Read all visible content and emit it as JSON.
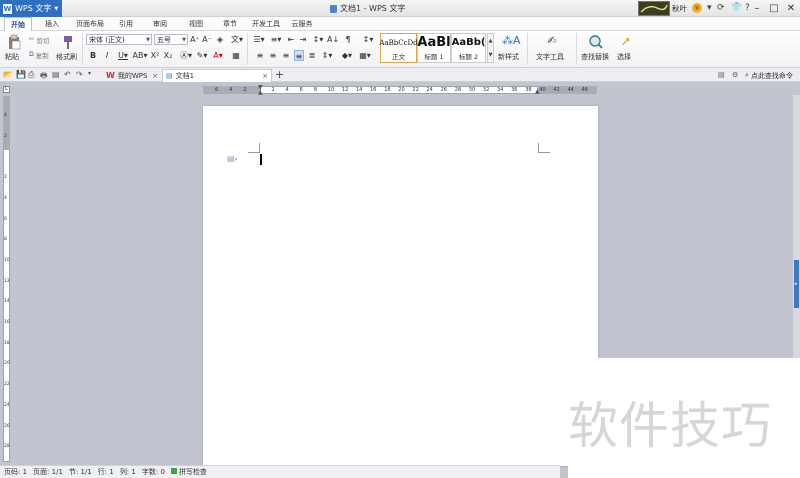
{
  "app": {
    "name": "WPS 文字",
    "title": "文档1 - WPS 文字",
    "user": "秋叶"
  },
  "menu": [
    "开始",
    "插入",
    "页面布局",
    "引用",
    "审阅",
    "视图",
    "章节",
    "开发工具",
    "云服务"
  ],
  "ribbon": {
    "paste": "粘贴",
    "cut": "剪切",
    "copy": "复制",
    "format_painter": "格式刷",
    "font": "宋体 (正文)",
    "size": "五号",
    "styles": [
      {
        "preview": "AaBbCcDd",
        "name": "正文"
      },
      {
        "preview": "AaBl",
        "name": "标题 1"
      },
      {
        "preview": "AaBb(",
        "name": "标题 2"
      }
    ],
    "new_style": "新样式",
    "text_tools": "文字工具",
    "find_replace": "查找替换",
    "select": "选择"
  },
  "tabs": {
    "my_wps": "我的WPS",
    "doc": "文档1",
    "find_cmd": "点此查找命令"
  },
  "ruler_ticks": [
    "6",
    "4",
    "2",
    "",
    "2",
    "4",
    "6",
    "8",
    "10",
    "12",
    "14",
    "16",
    "18",
    "20",
    "22",
    "24",
    "26",
    "28",
    "30",
    "32",
    "34",
    "36",
    "38",
    "40",
    "42",
    "44",
    "46"
  ],
  "vruler_ticks": [
    "4",
    "2",
    "",
    "2",
    "4",
    "6",
    "8",
    "10",
    "12",
    "14",
    "16",
    "18",
    "20",
    "22",
    "24",
    "26",
    "28"
  ],
  "status": {
    "page": "页码: 1",
    "pages": "页面: 1/1",
    "section": "节: 1/1",
    "row": "行: 1",
    "col": "列: 1",
    "words": "字数: 0",
    "spell": "拼写检查"
  },
  "watermark": "软件技巧",
  "colors": {
    "accent": "#2f6fc0",
    "scroll_thumb": "#3c78c8"
  }
}
